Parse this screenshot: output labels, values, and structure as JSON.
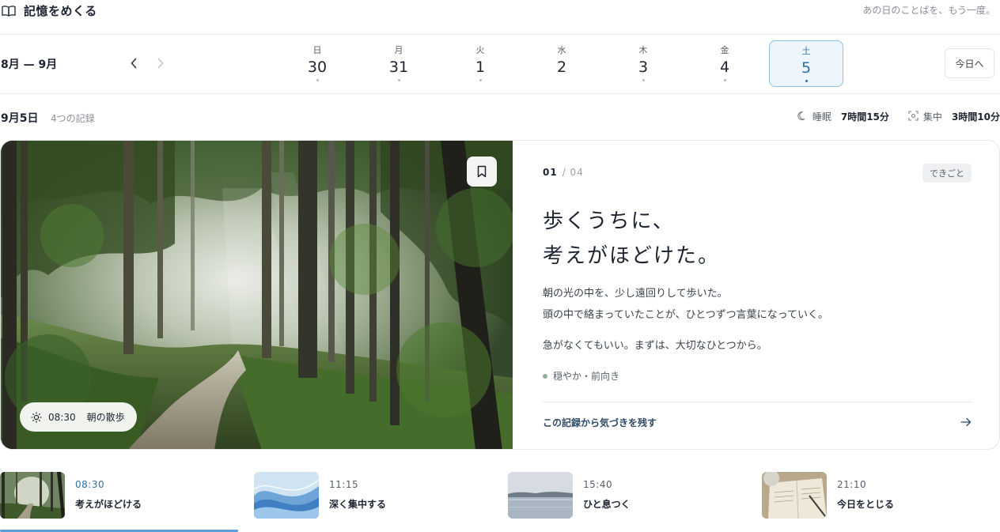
{
  "header": {
    "title": "記憶をめくる",
    "tagline": "あの日のことばを、もう一度。"
  },
  "week": {
    "range": "8月 — 9月",
    "today_label": "今日へ",
    "days": [
      {
        "dow": "日",
        "num": "30"
      },
      {
        "dow": "月",
        "num": "31"
      },
      {
        "dow": "火",
        "num": "1"
      },
      {
        "dow": "水",
        "num": "2"
      },
      {
        "dow": "木",
        "num": "3"
      },
      {
        "dow": "金",
        "num": "4"
      },
      {
        "dow": "土",
        "num": "5",
        "selected": true
      }
    ]
  },
  "summary": {
    "date": "9月5日",
    "count": "4つの記録",
    "sleep_label": "睡眠",
    "sleep_value": "7時間15分",
    "focus_label": "集中",
    "focus_value": "3時間10分"
  },
  "entry": {
    "index": "01",
    "total": "/ 04",
    "tag": "できごと",
    "headline_1": "歩くうちに、",
    "headline_2": "考えがほどけた。",
    "body_1": "朝の光の中を、少し遠回りして歩いた。",
    "body_2": "頭の中で絡まっていたことが、ひとつずつ言葉になっていく。",
    "body_3": "急がなくてもいい。まずは、大切なひとつから。",
    "mood": "穏やか・前向き",
    "insight_link": "この記録から気づきを残す",
    "photo_time": "08:30",
    "photo_caption": "朝の散歩"
  },
  "timeline": [
    {
      "time": "08:30",
      "title": "考えがほどける",
      "active": true
    },
    {
      "time": "11:15",
      "title": "深く集中する"
    },
    {
      "time": "15:40",
      "title": "ひと息つく"
    },
    {
      "time": "21:10",
      "title": "今日をとじる"
    }
  ],
  "colors": {
    "accent": "#2d6fa7",
    "selected_bg": "#eef6fd",
    "progress": "#5b9fd6"
  }
}
